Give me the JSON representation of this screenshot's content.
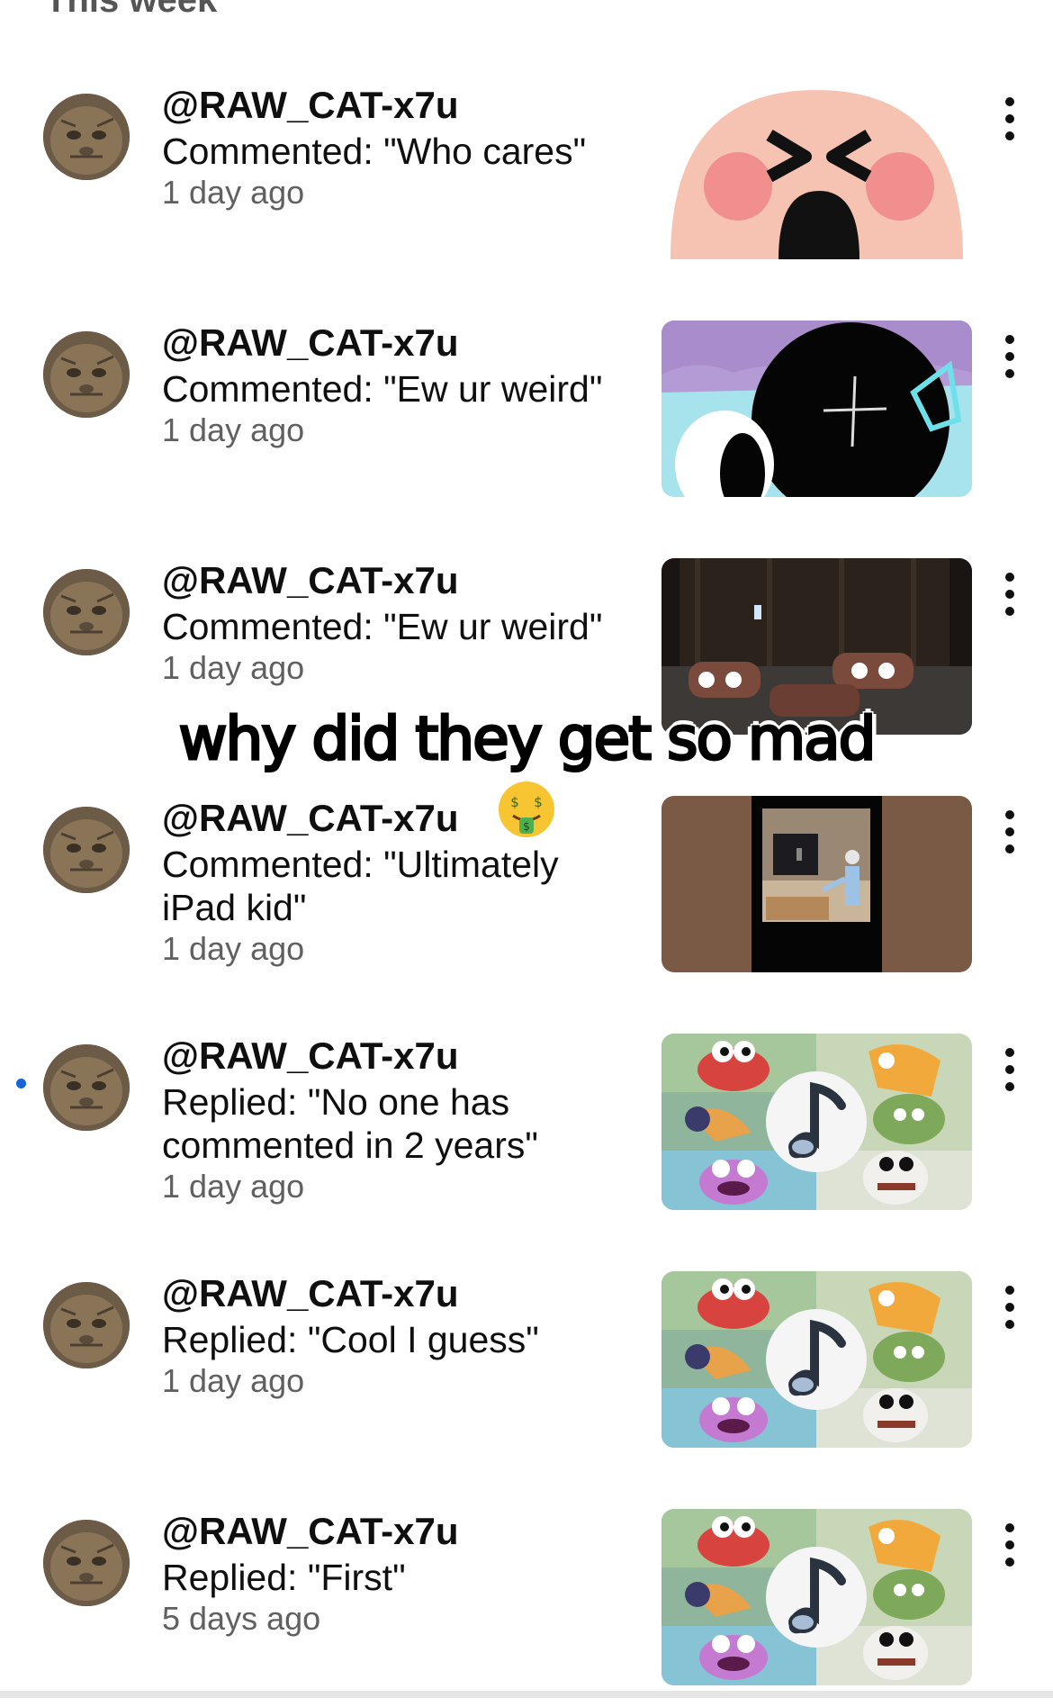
{
  "section": {
    "title": "This week"
  },
  "caption": "why did they get so mad",
  "notifications": [
    {
      "username": "@RAW_CAT-x7u",
      "message": "Commented: \"Who cares\"",
      "time": "1 day ago",
      "unread": false,
      "thumbnail": "crying-face-emoji-thumbnail"
    },
    {
      "username": "@RAW_CAT-x7u",
      "message": "Commented: \"Ew ur weird\"",
      "time": "1 day ago",
      "unread": false,
      "thumbnail": "cartoon-character-closeup-thumbnail"
    },
    {
      "username": "@RAW_CAT-x7u",
      "message": "Commented: \"Ew ur weird\"",
      "time": "1 day ago",
      "unread": false,
      "thumbnail": "dark-room-characters-thumbnail"
    },
    {
      "username": "@RAW_CAT-x7u",
      "message": "Commented: \"Ultimately iPad kid\"",
      "time": "1 day ago",
      "unread": false,
      "thumbnail": "safe-room-thumbnail"
    },
    {
      "username": "@RAW_CAT-x7u",
      "message": "Replied: \"No one has commented in 2 years\"",
      "time": "1 day ago",
      "unread": true,
      "thumbnail": "monsters-music-note-thumbnail"
    },
    {
      "username": "@RAW_CAT-x7u",
      "message": "Replied: \"Cool I guess\"",
      "time": "1 day ago",
      "unread": false,
      "thumbnail": "monsters-music-note-thumbnail"
    },
    {
      "username": "@RAW_CAT-x7u",
      "message": "Replied: \"First\"",
      "time": "5 days ago",
      "unread": false,
      "thumbnail": "monsters-music-note-thumbnail"
    }
  ],
  "colors": {
    "unread_dot": "#1565d8",
    "secondary_text": "#606060"
  },
  "icons": {
    "more": "more-vertical-icon",
    "caption_emoji": "money-mouth-face-emoji"
  }
}
